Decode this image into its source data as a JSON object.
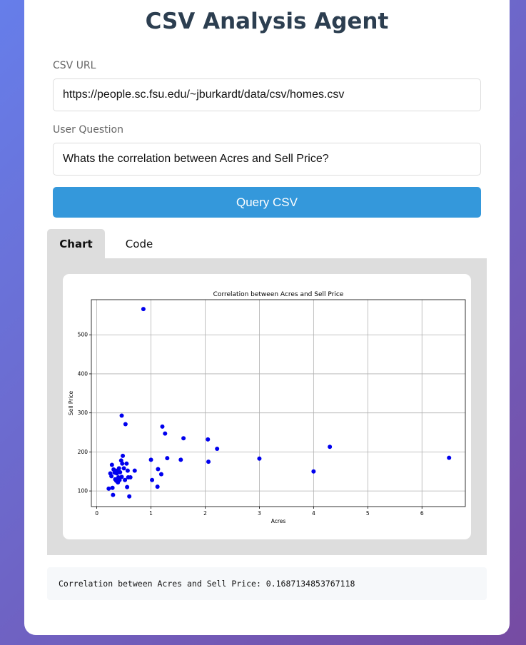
{
  "app": {
    "title": "CSV Analysis Agent"
  },
  "form": {
    "csv_url_label": "CSV URL",
    "csv_url_value": "https://people.sc.fsu.edu/~jburkardt/data/csv/homes.csv",
    "question_label": "User Question",
    "question_value": "Whats the correlation between Acres and Sell Price?",
    "submit_label": "Query CSV"
  },
  "tabs": [
    {
      "label": "Chart",
      "active": true
    },
    {
      "label": "Code",
      "active": false
    }
  ],
  "output": {
    "text": "Correlation between Acres and Sell Price: 0.1687134853767118"
  },
  "colors": {
    "accent": "#3498db",
    "title": "#2c3e50",
    "marker": "#0000ee"
  },
  "chart_data": {
    "type": "scatter",
    "title": "Correlation between Acres and Sell Price",
    "xlabel": "Acres",
    "ylabel": "Sell Price",
    "xlim": [
      -0.1,
      6.8
    ],
    "ylim": [
      60,
      590
    ],
    "xticks": [
      0,
      1,
      2,
      3,
      4,
      5,
      6
    ],
    "yticks": [
      100,
      200,
      300,
      400,
      500
    ],
    "grid": true,
    "series": [
      {
        "x": [
          0.22,
          0.25,
          0.27,
          0.28,
          0.29,
          0.3,
          0.31,
          0.33,
          0.34,
          0.35,
          0.36,
          0.37,
          0.38,
          0.39,
          0.4,
          0.41,
          0.42,
          0.43,
          0.45,
          0.46,
          0.47,
          0.48,
          0.5,
          0.52,
          0.55,
          0.56,
          0.57,
          0.58,
          0.6,
          0.62,
          0.7,
          0.46,
          0.53,
          0.86,
          1.0,
          1.02,
          1.12,
          1.13,
          1.19,
          1.21,
          1.26,
          1.3,
          1.55,
          1.6,
          2.05,
          2.06,
          2.22,
          3.0,
          4.0,
          4.3,
          6.5
        ],
        "y": [
          106,
          145,
          138,
          167,
          108,
          90,
          155,
          147,
          130,
          152,
          126,
          145,
          150,
          122,
          135,
          158,
          128,
          148,
          178,
          136,
          170,
          190,
          158,
          128,
          170,
          110,
          152,
          135,
          86,
          135,
          152,
          293,
          271,
          566,
          180,
          128,
          111,
          156,
          143,
          265,
          247,
          184,
          180,
          235,
          232,
          175,
          208,
          183,
          150,
          213,
          185
        ]
      }
    ]
  }
}
